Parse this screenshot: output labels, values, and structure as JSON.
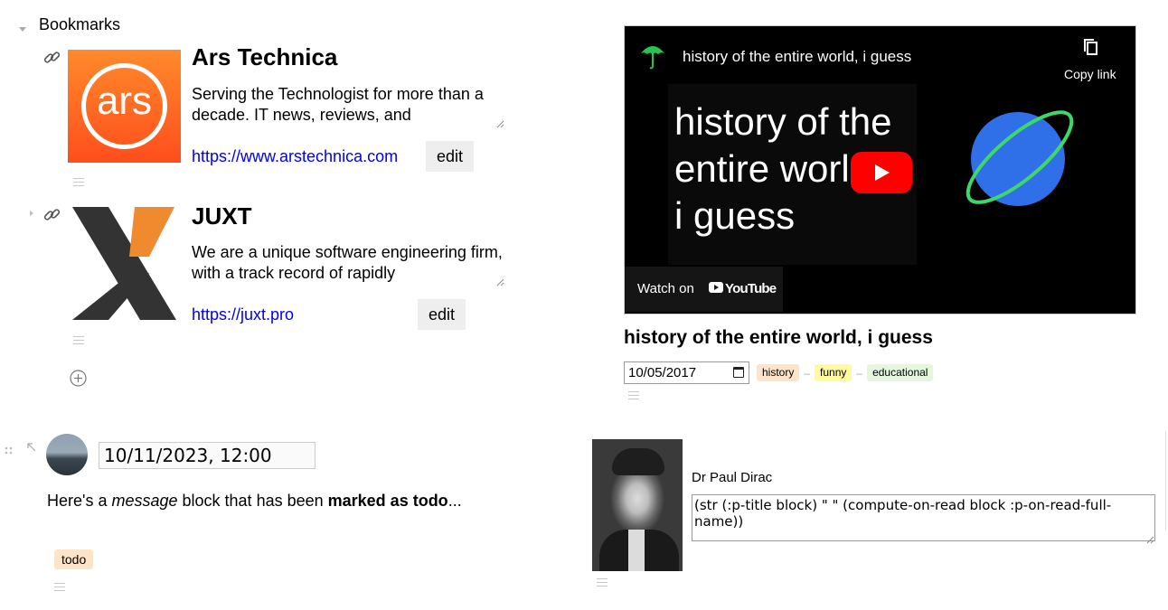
{
  "bookmarks": {
    "heading": "Bookmarks",
    "items": [
      {
        "title": "Ars Technica",
        "logo_text": "ars",
        "description": "Serving the Technologist for more than a decade. IT news, reviews, and",
        "url": "https://www.arstechnica.com",
        "edit_label": "edit"
      },
      {
        "title": "JUXT",
        "description": "We are a unique software engineering firm, with a track record of rapidly",
        "url": "https://juxt.pro",
        "edit_label": "edit"
      }
    ],
    "add_icon": "plus-circle-icon"
  },
  "video": {
    "header_title": "history of the entire world, i guess",
    "copy_label": "Copy link",
    "thumbnail_text_line1": "history of the",
    "thumbnail_text_line2": "entire worl",
    "thumbnail_text_line3": "i guess",
    "watch_on": "Watch on",
    "youtube_label": "YouTube",
    "title": "history of the entire world, i guess",
    "date": "10/05/2017",
    "tags": [
      {
        "label": "history",
        "color": "#fde3c8"
      },
      {
        "label": "funny",
        "color": "#fffa9e"
      },
      {
        "label": "educational",
        "color": "#e2f7dc"
      }
    ],
    "tag_separator": "–"
  },
  "message": {
    "datetime": "10/11/2023, 12:00",
    "text_prefix": "Here's a ",
    "text_em": "message",
    "text_mid": " block that has been ",
    "text_strong": "marked as todo",
    "text_suffix": "...",
    "tag": "todo",
    "tag_color": "#fde3c8"
  },
  "person": {
    "name": "Dr Paul Dirac",
    "formula": "(str (:p-title block) \" \" (compute-on-read block :p-on-read-full-name))"
  }
}
